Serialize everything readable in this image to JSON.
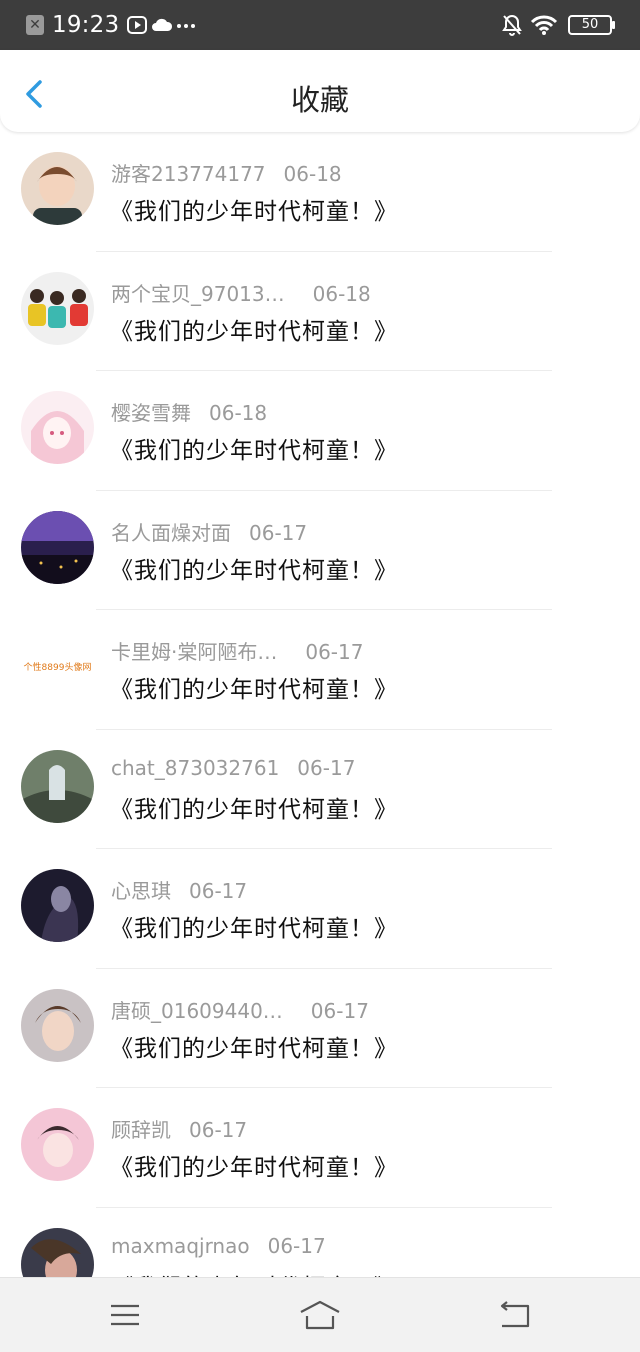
{
  "status_bar": {
    "time": "19:23",
    "battery": "50"
  },
  "header": {
    "title": "收藏"
  },
  "items": [
    {
      "name": "游客213774177",
      "date": "06-18",
      "text": "《我们的少年时代柯童！》"
    },
    {
      "name": "两个宝贝_97013…",
      "date": "06-18",
      "text": "《我们的少年时代柯童！》"
    },
    {
      "name": "樱姿雪舞",
      "date": "06-18",
      "text": "《我们的少年时代柯童！》"
    },
    {
      "name": "名人面燥对面",
      "date": "06-17",
      "text": "《我们的少年时代柯童！》"
    },
    {
      "name": "卡里姆·棠阿陋布…",
      "date": "06-17",
      "text": "《我们的少年时代柯童！》",
      "avatar_caption": "个性8899头像网"
    },
    {
      "name": "chat_873032761",
      "date": "06-17",
      "text": "《我们的少年时代柯童！》"
    },
    {
      "name": "心思琪",
      "date": "06-17",
      "text": "《我们的少年时代柯童！》"
    },
    {
      "name": "唐硕_01609440…",
      "date": "06-17",
      "text": "《我们的少年时代柯童！》"
    },
    {
      "name": "顾辞凯",
      "date": "06-17",
      "text": "《我们的少年时代柯童！》"
    },
    {
      "name": "maxmaqjrnao",
      "date": "06-17",
      "text": "《我们的少年时代柯童！》"
    }
  ],
  "icons": {
    "back": "chevron-left-icon",
    "menu": "menu-icon",
    "home": "home-icon",
    "return": "return-icon"
  },
  "colors": {
    "accent": "#2f9be0",
    "status_bar": "#3d3d3d"
  }
}
